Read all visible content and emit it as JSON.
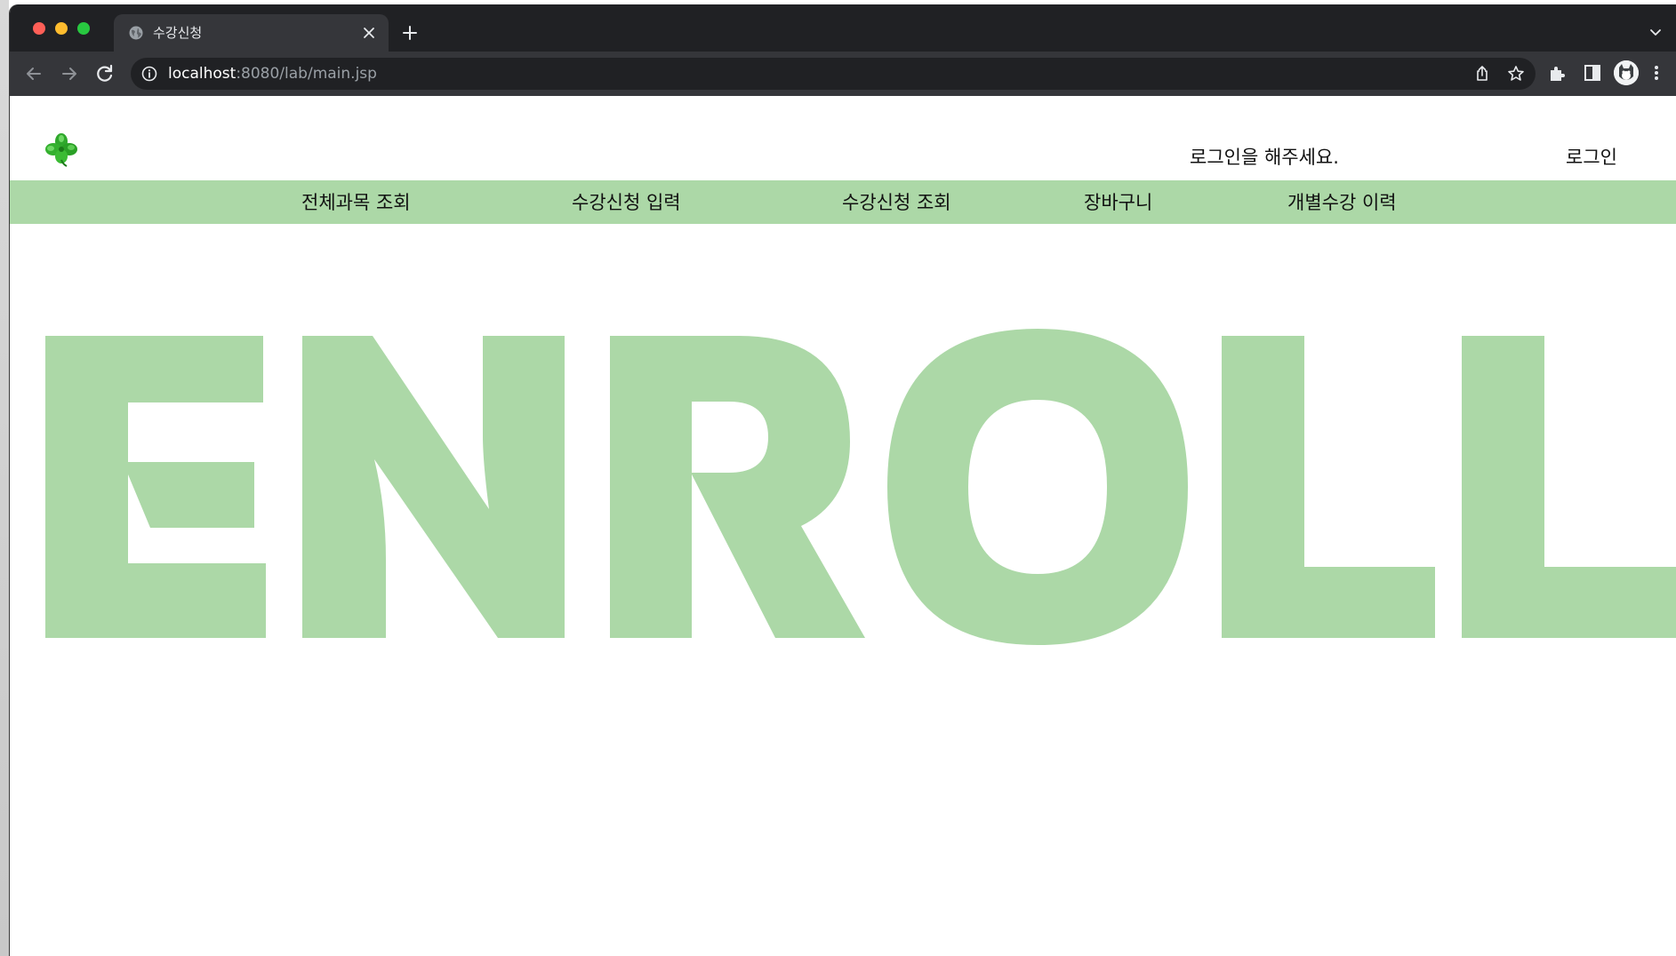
{
  "browser": {
    "tab": {
      "title": "수강신청",
      "favicon": "globe-icon"
    },
    "address_bar": {
      "host": "localhost",
      "path": ":8080/lab/main.jsp"
    },
    "colors": {
      "tabstrip_bg": "#202124",
      "toolbar_bg": "#35363a",
      "omnibox_bg": "#202124"
    }
  },
  "header": {
    "logo": "four-leaf-clover-icon",
    "login_message": "로그인을 해주세요.",
    "login_link": "로그인"
  },
  "nav": {
    "items": [
      {
        "label": "전체과목 조회"
      },
      {
        "label": "수강신청 입력"
      },
      {
        "label": "수강신청 조회"
      },
      {
        "label": "장바구니"
      },
      {
        "label": "개별수강 이력"
      }
    ],
    "bg_color": "#acd8a7"
  },
  "hero": {
    "text": "ENROLL",
    "color": "#acd8a7"
  }
}
